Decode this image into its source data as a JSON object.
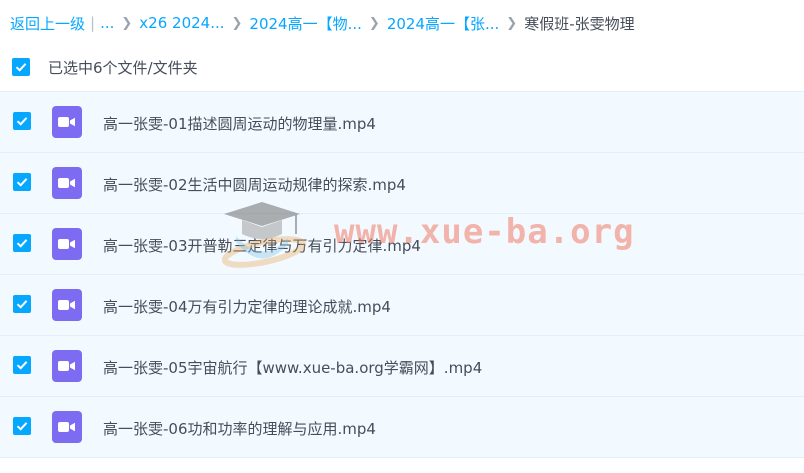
{
  "breadcrumb": {
    "back_label": "返回上一级",
    "separator_bar": "|",
    "ellipsis": "...",
    "items": [
      {
        "label": "x26 2024..."
      },
      {
        "label": "2024高一【物..."
      },
      {
        "label": "2024高一【张..."
      }
    ],
    "current": "寒假班-张雯物理",
    "separator_icon": "chevron-right-icon"
  },
  "selection": {
    "label": "已选中6个文件/文件夹",
    "checked": true
  },
  "files": [
    {
      "name": "高一张雯-01描述圆周运动的物理量.mp4",
      "checked": true,
      "icon": "video-file-icon"
    },
    {
      "name": "高一张雯-02生活中圆周运动规律的探索.mp4",
      "checked": true,
      "icon": "video-file-icon"
    },
    {
      "name": "高一张雯-03开普勒三定律与万有引力定律.mp4",
      "checked": true,
      "icon": "video-file-icon"
    },
    {
      "name": "高一张雯-04万有引力定律的理论成就.mp4",
      "checked": true,
      "icon": "video-file-icon"
    },
    {
      "name": "高一张雯-05宇宙航行【www.xue-ba.org学霸网】.mp4",
      "checked": true,
      "icon": "video-file-icon"
    },
    {
      "name": "高一张雯-06功和功率的理解与应用.mp4",
      "checked": true,
      "icon": "video-file-icon"
    }
  ],
  "watermark": {
    "text": "www.xue-ba.org",
    "icon": "graduation-cap-logo-icon"
  },
  "colors": {
    "accent": "#06a7ff",
    "row_background": "#f3faff",
    "video_icon": "#7d6cf2",
    "watermark": "#ee7864"
  }
}
